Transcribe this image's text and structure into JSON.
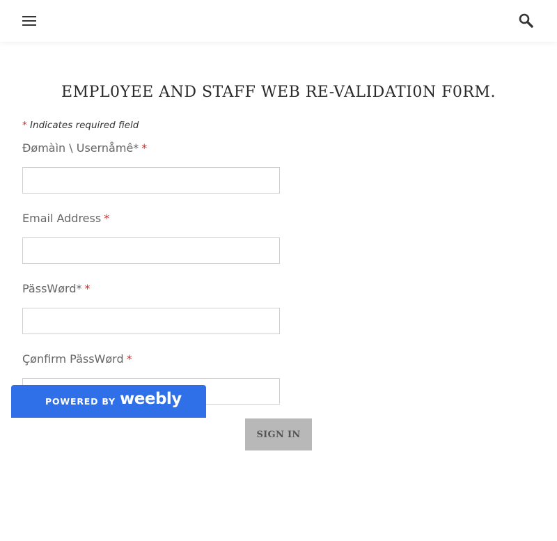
{
  "header": {
    "menu_icon": "hamburger-menu-icon",
    "search_icon": "search-icon"
  },
  "form": {
    "title": "EMPL0YEE AND STAFF WEB RE-VALIDATI0N F0RM.",
    "required_note_star": "*",
    "required_note_text": " Indicates required field",
    "fields": [
      {
        "label": "Đømàìn \\ Usernåmê*",
        "required_mark": "*",
        "value": ""
      },
      {
        "label": "Email Address",
        "required_mark": "*",
        "value": ""
      },
      {
        "label": "PässWørd*",
        "required_mark": "*",
        "value": ""
      },
      {
        "label": "Çønfirm PässWørd",
        "required_mark": "*",
        "value": ""
      }
    ],
    "submit_label": "SIGN IN"
  },
  "badge": {
    "powered_by": "POWERED BY",
    "brand": "weebly"
  },
  "colors": {
    "required_star": "#d92b2b",
    "badge_background": "#2f6fe8",
    "button_background": "#b8b8b8"
  }
}
